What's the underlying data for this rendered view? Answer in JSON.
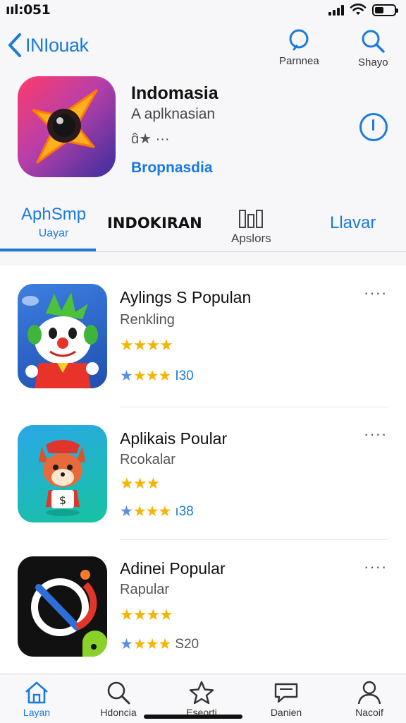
{
  "status_bar": {
    "time": "ııl:051"
  },
  "nav": {
    "back_label": "INIouak",
    "actions": [
      {
        "label": "Parnnea",
        "icon": "heart-outline-icon"
      },
      {
        "label": "Shayo",
        "icon": "search-icon"
      }
    ]
  },
  "app": {
    "title": "Indomasia",
    "subtitle": "A aplknasian",
    "rating_text": "ɑ̂★ ···",
    "link": "Bropnasdia",
    "accent_color": "#1a7ae0"
  },
  "tabs": [
    {
      "label": "AphSmp",
      "sublabel": "Uayar",
      "active": true
    },
    {
      "label": "INDOKIRAN",
      "sublabel": ""
    },
    {
      "label": "Apslors",
      "icon": "app-grid-icon"
    },
    {
      "label": "Llavar"
    }
  ],
  "list": [
    {
      "title": "Aylings S Populan",
      "subtitle": "Renkling",
      "stars": "★★★★",
      "rating_stars": "★★★",
      "count": "I30",
      "more": "····"
    },
    {
      "title": "Aplikais Poular",
      "subtitle": "Rcokalar",
      "stars": "★★★",
      "rating_stars": "★★★",
      "count": "ı38",
      "more": "····"
    },
    {
      "title": "Adinei Popular",
      "subtitle": "Rapular",
      "stars": "★★★★",
      "rating_stars": "★★★",
      "count": "S20",
      "more": "····"
    }
  ],
  "tabbar": [
    {
      "label": "Layan",
      "icon": "home-icon",
      "active": true
    },
    {
      "label": "Hdoncia",
      "icon": "search-icon"
    },
    {
      "label": "Eseorti",
      "icon": "star-icon"
    },
    {
      "label": "Danien",
      "icon": "chat-icon"
    },
    {
      "label": "Nacoif",
      "icon": "person-icon"
    }
  ]
}
